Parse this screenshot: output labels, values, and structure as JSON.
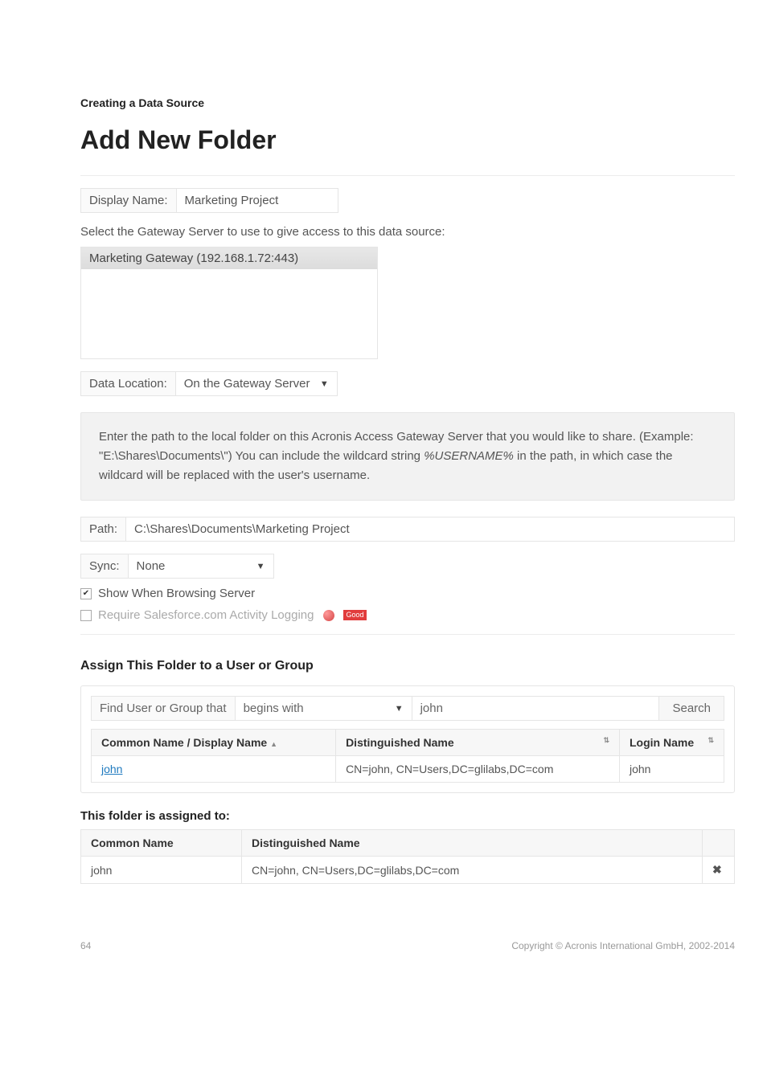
{
  "header": {
    "section_label": "Creating a Data Source",
    "page_title": "Add New Folder"
  },
  "display_name": {
    "label": "Display Name:",
    "value": "Marketing Project"
  },
  "gateway": {
    "instruction": "Select the Gateway Server to use to give access to this data source:",
    "selected": "Marketing Gateway (192.168.1.72:443)"
  },
  "data_location": {
    "label": "Data Location:",
    "value": "On the Gateway Server"
  },
  "info": {
    "line1": "Enter the path to the local folder on this Acronis Access Gateway Server that you would like to share. (Example: \"E:\\Shares\\Documents\\\") You can include the wildcard string ",
    "wildcard": "%USERNAME%",
    "line2": " in the path, in which case the wildcard will be replaced with the user's username."
  },
  "path": {
    "label": "Path:",
    "value": "C:\\Shares\\Documents\\Marketing Project"
  },
  "sync": {
    "label": "Sync:",
    "value": "None"
  },
  "checkboxes": {
    "show_browsing": {
      "label": "Show When Browsing Server",
      "checked": true
    },
    "require_sf": {
      "label": "Require Salesforce.com Activity Logging",
      "checked": false,
      "badge_text": "Good"
    }
  },
  "assign": {
    "heading": "Assign This Folder to a User or Group",
    "search": {
      "label": "Find User or Group that",
      "mode": "begins with",
      "query": "john",
      "button": "Search"
    },
    "columns": {
      "common": "Common Name / Display Name",
      "dn": "Distinguished Name",
      "login": "Login Name"
    },
    "results": [
      {
        "common": "john",
        "dn": "CN=john, CN=Users,DC=glilabs,DC=com",
        "login": "john"
      }
    ]
  },
  "assigned_to": {
    "heading": "This folder is assigned to:",
    "columns": {
      "common": "Common Name",
      "dn": "Distinguished Name"
    },
    "rows": [
      {
        "common": "john",
        "dn": "CN=john, CN=Users,DC=glilabs,DC=com"
      }
    ]
  },
  "footer": {
    "page": "64",
    "copyright": "Copyright © Acronis International GmbH, 2002-2014"
  }
}
